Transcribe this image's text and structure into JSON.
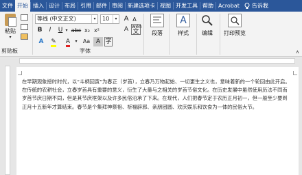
{
  "tabs": [
    "文件",
    "开始",
    "插入",
    "设计",
    "布局",
    "引用",
    "邮件",
    "审阅",
    "新建选项卡",
    "视图",
    "开发工具",
    "帮助",
    "Acrobat"
  ],
  "active_tab": "开始",
  "tell_me": "告诉我",
  "clipboard": {
    "paste_label": "粘贴",
    "group_label": "剪贴板"
  },
  "font": {
    "name": "等线 (中文正文)",
    "size": "10",
    "grow": "A",
    "shrink": "A",
    "clear": "A",
    "wen": "wén",
    "bold": "B",
    "italic": "I",
    "underline": "U",
    "strike": "abc",
    "subscript": "x₂",
    "superscript": "x²",
    "highlight_a": "A",
    "font_color_a": "A",
    "aa": "Aa",
    "border_a": "A",
    "group_label": "字体"
  },
  "paragraph": {
    "label": "段落"
  },
  "styles": {
    "label": "样式"
  },
  "editing": {
    "label": "编辑"
  },
  "print": {
    "label": "打印预览"
  },
  "colors": {
    "ribbon_blue": "#2b579a",
    "highlight": "#ffff00",
    "font_red": "#e02020"
  },
  "document": {
    "paragraph": "在早期观象授时时代，以“斗柄回寅”为春正（岁首），立春乃万物起始、一切更生之义也，意味着新的一个轮回由此开启。在传统的农耕社会，立春岁首具有重要的意义，衍生了大量与之相关的岁首节俗文化。在历史发展中虽然使用历法不同而岁首节庆日期不同，但是其节庆框架以及许多民俗沿承了下来。在现代，人们把春节定于农历正月初一，但一般至少要到正月十五新年才算结束。春节是个集拜神祭祖、祈福辟邪、亲朋团圆、欢庆娱乐和饮食为一体的民俗大节。"
  }
}
